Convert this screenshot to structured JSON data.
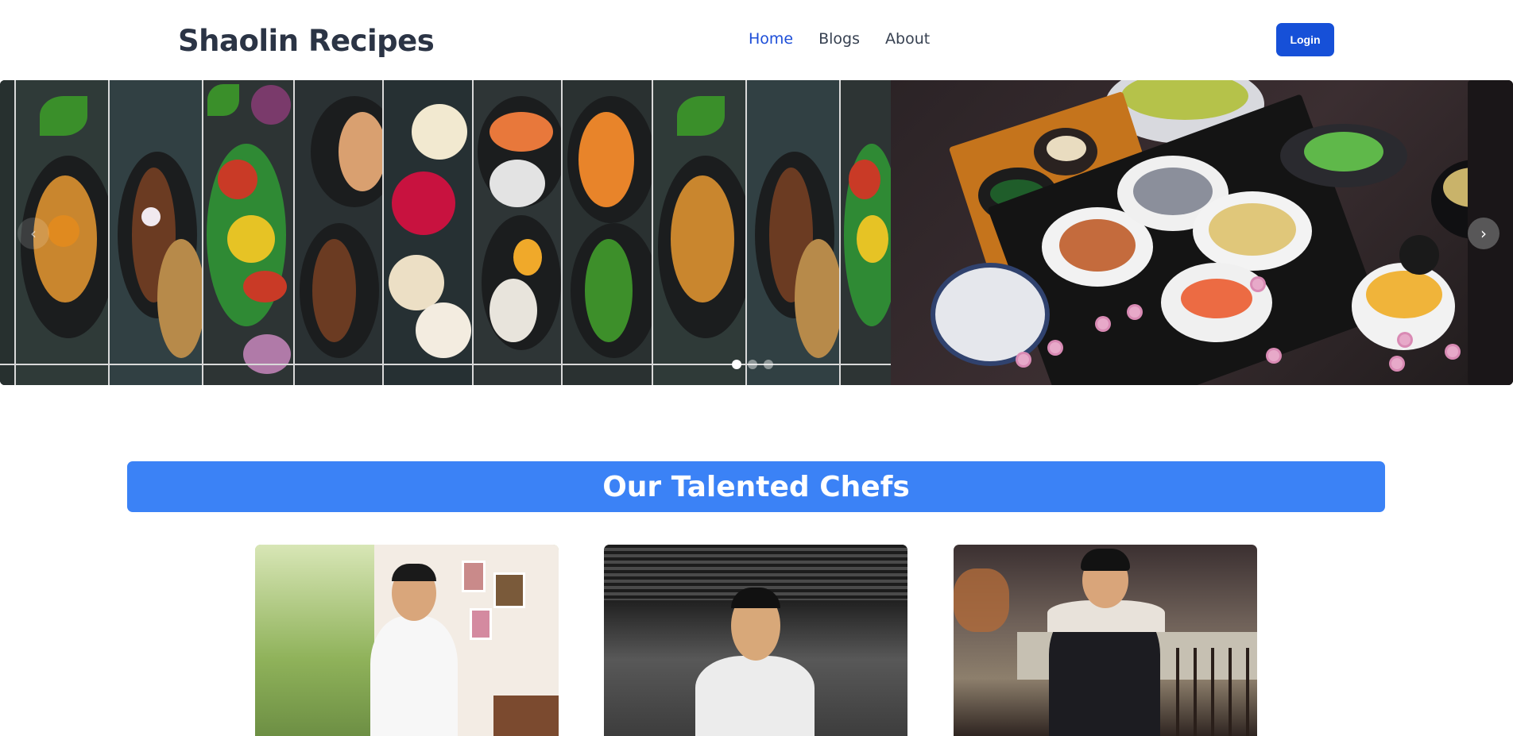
{
  "header": {
    "brand": "Shaolin Recipes",
    "nav": [
      {
        "label": "Home",
        "active": true
      },
      {
        "label": "Blogs",
        "active": false
      },
      {
        "label": "About",
        "active": false
      }
    ],
    "login_label": "Login"
  },
  "carousel": {
    "slides": [
      "mixed-grilled-dishes-collage",
      "japanese-bento-set-meal"
    ],
    "active_index": 0,
    "dot_count": 3,
    "prev_icon": "chevron-left-icon",
    "next_icon": "chevron-right-icon",
    "prev_glyph": "‹",
    "next_glyph": "›"
  },
  "chefs": {
    "title": "Our Talented Chefs",
    "cards": [
      {
        "photo": "chef-in-white-jacket-kitchen-window"
      },
      {
        "photo": "chef-in-white-jacket-outdoor-restaurant"
      },
      {
        "photo": "chef-in-apron-restaurant-bar"
      }
    ]
  },
  "colors": {
    "primary": "#1650d8",
    "banner": "#3b82f6",
    "nav_active": "#1d4ed8",
    "text_dark": "#2b3445"
  }
}
